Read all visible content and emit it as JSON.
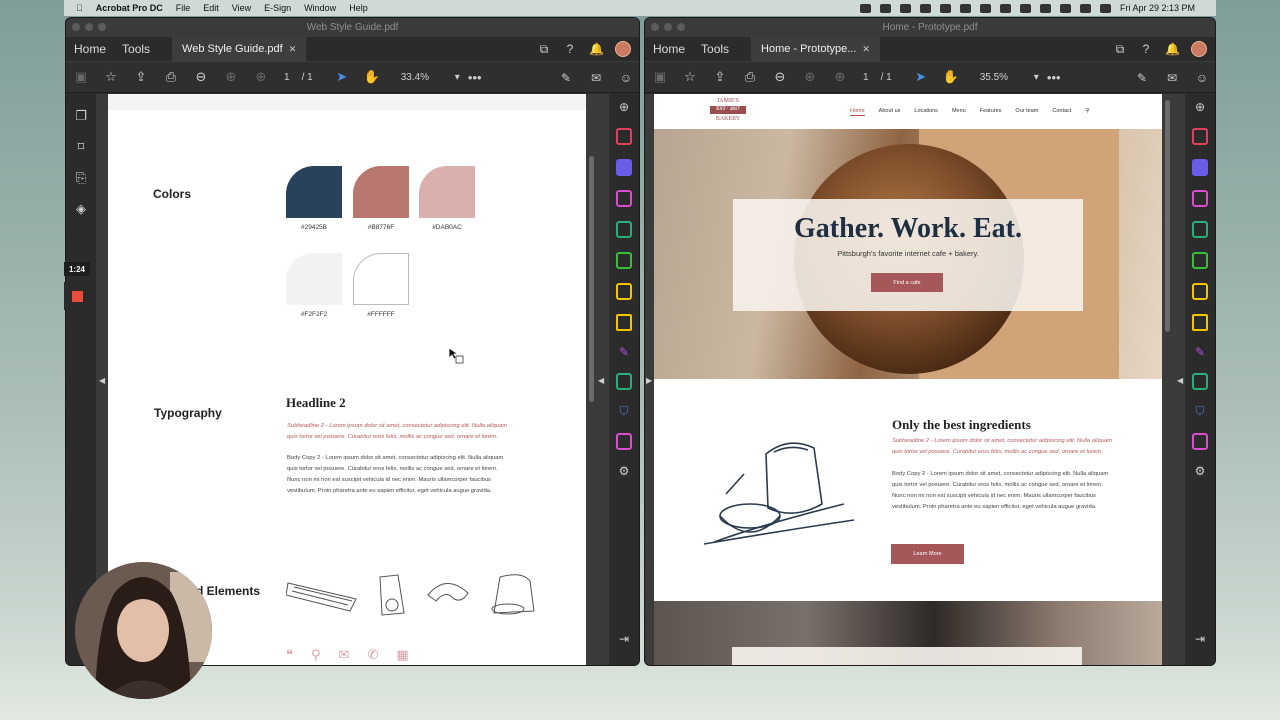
{
  "menubar": {
    "app_name": "Acrobat Pro DC",
    "menus": [
      "File",
      "Edit",
      "View",
      "E-Sign",
      "Window",
      "Help"
    ],
    "clock": "Fri Apr 29  2:13 PM"
  },
  "left_window": {
    "title": "Web Style Guide.pdf",
    "nav_home": "Home",
    "nav_tools": "Tools",
    "tab_label": "Web Style Guide.pdf",
    "page_current": "1",
    "page_total": "/ 1",
    "zoom": "33.4%",
    "more": "•••"
  },
  "right_window": {
    "title": "Home - Prototype.pdf",
    "nav_home": "Home",
    "nav_tools": "Tools",
    "tab_label": "Home - Prototype...",
    "page_current": "1",
    "page_total": "/ 1",
    "zoom": "35.5%",
    "more": "•••"
  },
  "recording": {
    "timer": "1:24"
  },
  "style_guide": {
    "colors_label": "Colors",
    "swatches": [
      {
        "hex": "#29425B",
        "label": "#29425B"
      },
      {
        "hex": "#B8776F",
        "label": "#B8776F"
      },
      {
        "hex": "#DAB0AC",
        "label": "#DAB0AC"
      },
      {
        "hex": "#F2F2F2",
        "label": "#F2F2F2"
      },
      {
        "hex": "#FFFFFF",
        "label": "#FFFFFF"
      }
    ],
    "typography_label": "Typography",
    "headline": "Headline 2",
    "subheadline_1": "Subheadline 2 - Lorem ipsum dolor sit amet, consectetur adipiscing elit. Nulla aliquam",
    "subheadline_2": "quis tortor vel posuere. Curabitur eros felis, mollis ac congue sed, ornare et lorem.",
    "body_1": "Body Copy 2 - Lorem ipsum dolor sit amet, consectetur adipiscing elit. Nulla aliquam",
    "body_2": "quis tortor vel posuere. Curabitur eros felis, mollis ac congue sed, ornare et lorem.",
    "body_3": "Nunc non mi non est suscipit vehicula id nec enim. Mauris ullamcorper faucibus",
    "body_4": "vestibulum. Proin pharetra ante eu sapien efficitur, eget vehicula augue gravida.",
    "elements_label": "d Elements"
  },
  "prototype": {
    "logo_top": "JAMIE'S",
    "logo_mid": "EST  ·  2017",
    "logo_bottom": "BAKERY",
    "nav": [
      "Home",
      "About us",
      "Locations",
      "Menu",
      "Features",
      "Our team",
      "Contact"
    ],
    "hero_title": "Gather. Work. Eat.",
    "hero_subtitle": "Pittsburgh's favorite internet cafe + bakery.",
    "hero_button": "Find a cafe",
    "section_title": "Only the best ingredients",
    "sub_1": "Subheadline 2 - Lorem ipsum dolor sit amet, consectetur adipiscing elit. Nulla aliquam",
    "sub_2": "quis tortor vel posuere. Curabitur eros felis, mollis ac congue sed, ornare et lorem.",
    "body_1": "Body Copy 2 - Lorem ipsum dolor sit amet, consectetur adipiscing elit. Nulla aliquam",
    "body_2": "quis tortor vel posuere. Curabitur eros felis, mollis ac congue sed, ornare et lorem.",
    "body_3": "Nunc non mi non est suscipit vehicula id nec enim. Mauris ullamcorper faucibus",
    "body_4": "vestibulum. Proin pharetra ante eu sapien efficitur, eget vehicula augue gravida.",
    "learn_button": "Learn More"
  },
  "colors": {
    "accent": "#a55759",
    "blue_tool": "#4a8eea"
  }
}
